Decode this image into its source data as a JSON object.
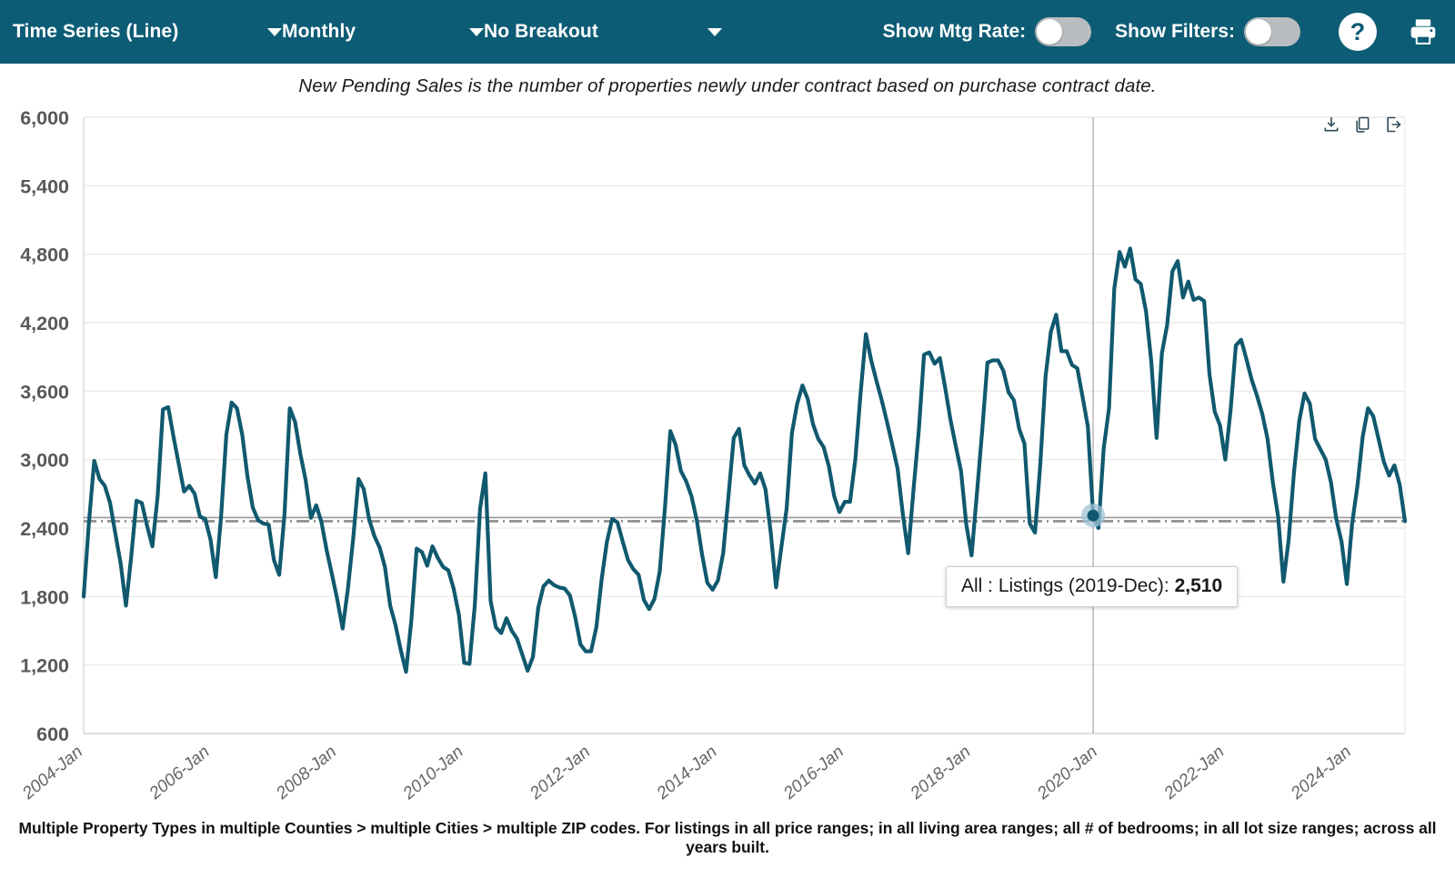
{
  "toolbar": {
    "chart_type": "Time Series (Line)",
    "interval": "Monthly",
    "breakout": "No Breakout",
    "show_mtg_rate_label": "Show Mtg Rate:",
    "show_filters_label": "Show Filters:",
    "help_label": "?",
    "print_icon": "printer-icon",
    "mtg_rate_on": false,
    "filters_on": false,
    "accent_color": "#0d5c75"
  },
  "subtitle": "New Pending Sales is the number of properties newly under contract based on purchase contract date.",
  "tooltip": {
    "prefix": "All : Listings (2019-Dec): ",
    "value": "2,510"
  },
  "export": {
    "download": "download-icon",
    "copy": "copy-icon",
    "export": "export-icon"
  },
  "footer": "Multiple Property Types in multiple Counties > multiple Cities > multiple ZIP codes. For listings in all price ranges; in all living area ranges; all # of bedrooms; in all lot size ranges; across all years built.",
  "chart_data": {
    "type": "line",
    "title": "",
    "subtitle": "New Pending Sales is the number of properties newly under contract based on purchase contract date.",
    "xlabel": "",
    "ylabel": "",
    "ylim": [
      600,
      6000
    ],
    "ytick_values": [
      600,
      1200,
      1800,
      2400,
      3000,
      3600,
      4200,
      4800,
      5400,
      6000
    ],
    "ytick_labels": [
      "600",
      "1,200",
      "1,800",
      "2,400",
      "3,000",
      "3,600",
      "4,200",
      "4,800",
      "5,400",
      "6,000"
    ],
    "xtick_labels": [
      "2004-Jan",
      "2006-Jan",
      "2008-Jan",
      "2010-Jan",
      "2012-Jan",
      "2014-Jan",
      "2016-Jan",
      "2018-Jan",
      "2020-Jan",
      "2022-Jan",
      "2024-Jan"
    ],
    "xtick_indices": [
      0,
      24,
      48,
      72,
      96,
      120,
      144,
      168,
      192,
      216,
      240
    ],
    "grid": true,
    "legend": "none",
    "line_color": "#10596f",
    "average_line": 2460,
    "average_line_style": "dash-dot",
    "highlight": {
      "index": 191,
      "label": "2019-Dec",
      "value": 2510
    },
    "x_start": "2004-Jan",
    "x_end": "2024-Sep",
    "series": [
      {
        "name": "All : Listings",
        "values": [
          1800,
          2450,
          2990,
          2830,
          2770,
          2620,
          2350,
          2090,
          1720,
          2150,
          2640,
          2620,
          2420,
          2240,
          2680,
          3440,
          3460,
          3200,
          2960,
          2720,
          2770,
          2700,
          2500,
          2480,
          2300,
          1970,
          2500,
          3220,
          3500,
          3450,
          3220,
          2850,
          2580,
          2470,
          2440,
          2430,
          2120,
          1990,
          2520,
          3450,
          3330,
          3050,
          2820,
          2490,
          2600,
          2450,
          2200,
          1990,
          1770,
          1520,
          1870,
          2310,
          2830,
          2740,
          2480,
          2330,
          2230,
          2060,
          1720,
          1550,
          1330,
          1140,
          1590,
          2220,
          2190,
          2070,
          2240,
          2140,
          2060,
          2030,
          1870,
          1640,
          1220,
          1210,
          1720,
          2570,
          2880,
          1760,
          1530,
          1480,
          1610,
          1500,
          1430,
          1290,
          1150,
          1270,
          1700,
          1890,
          1940,
          1900,
          1880,
          1870,
          1810,
          1620,
          1380,
          1320,
          1320,
          1530,
          1950,
          2280,
          2480,
          2450,
          2280,
          2120,
          2040,
          1990,
          1770,
          1690,
          1780,
          2020,
          2590,
          3250,
          3130,
          2900,
          2810,
          2680,
          2470,
          2170,
          1920,
          1860,
          1940,
          2180,
          2680,
          3190,
          3270,
          2950,
          2860,
          2790,
          2880,
          2740,
          2360,
          1880,
          2230,
          2570,
          3230,
          3490,
          3650,
          3530,
          3310,
          3180,
          3110,
          2940,
          2680,
          2540,
          2630,
          2630,
          3000,
          3580,
          4100,
          3870,
          3690,
          3520,
          3330,
          3130,
          2920,
          2520,
          2180,
          2730,
          3250,
          3920,
          3940,
          3840,
          3890,
          3630,
          3350,
          3120,
          2900,
          2430,
          2160,
          2700,
          3250,
          3850,
          3870,
          3870,
          3780,
          3590,
          3520,
          3270,
          3140,
          2440,
          2360,
          2960,
          3730,
          4120,
          4270,
          3950,
          3950,
          3830,
          3800,
          3550,
          3290,
          2510,
          2400,
          3100,
          3450,
          4500,
          4820,
          4690,
          4850,
          4580,
          4540,
          4300,
          3860,
          3190,
          3930,
          4180,
          4650,
          4740,
          4420,
          4560,
          4400,
          4420,
          4390,
          3750,
          3420,
          3300,
          3000,
          3430,
          4000,
          4050,
          3880,
          3700,
          3560,
          3400,
          3180,
          2800,
          2500,
          1930,
          2300,
          2890,
          3340,
          3580,
          3490,
          3180,
          3090,
          3000,
          2800,
          2480,
          2280,
          1910,
          2440,
          2770,
          3200,
          3450,
          3380,
          3180,
          2980,
          2860,
          2950,
          2780,
          2460
        ]
      }
    ]
  }
}
